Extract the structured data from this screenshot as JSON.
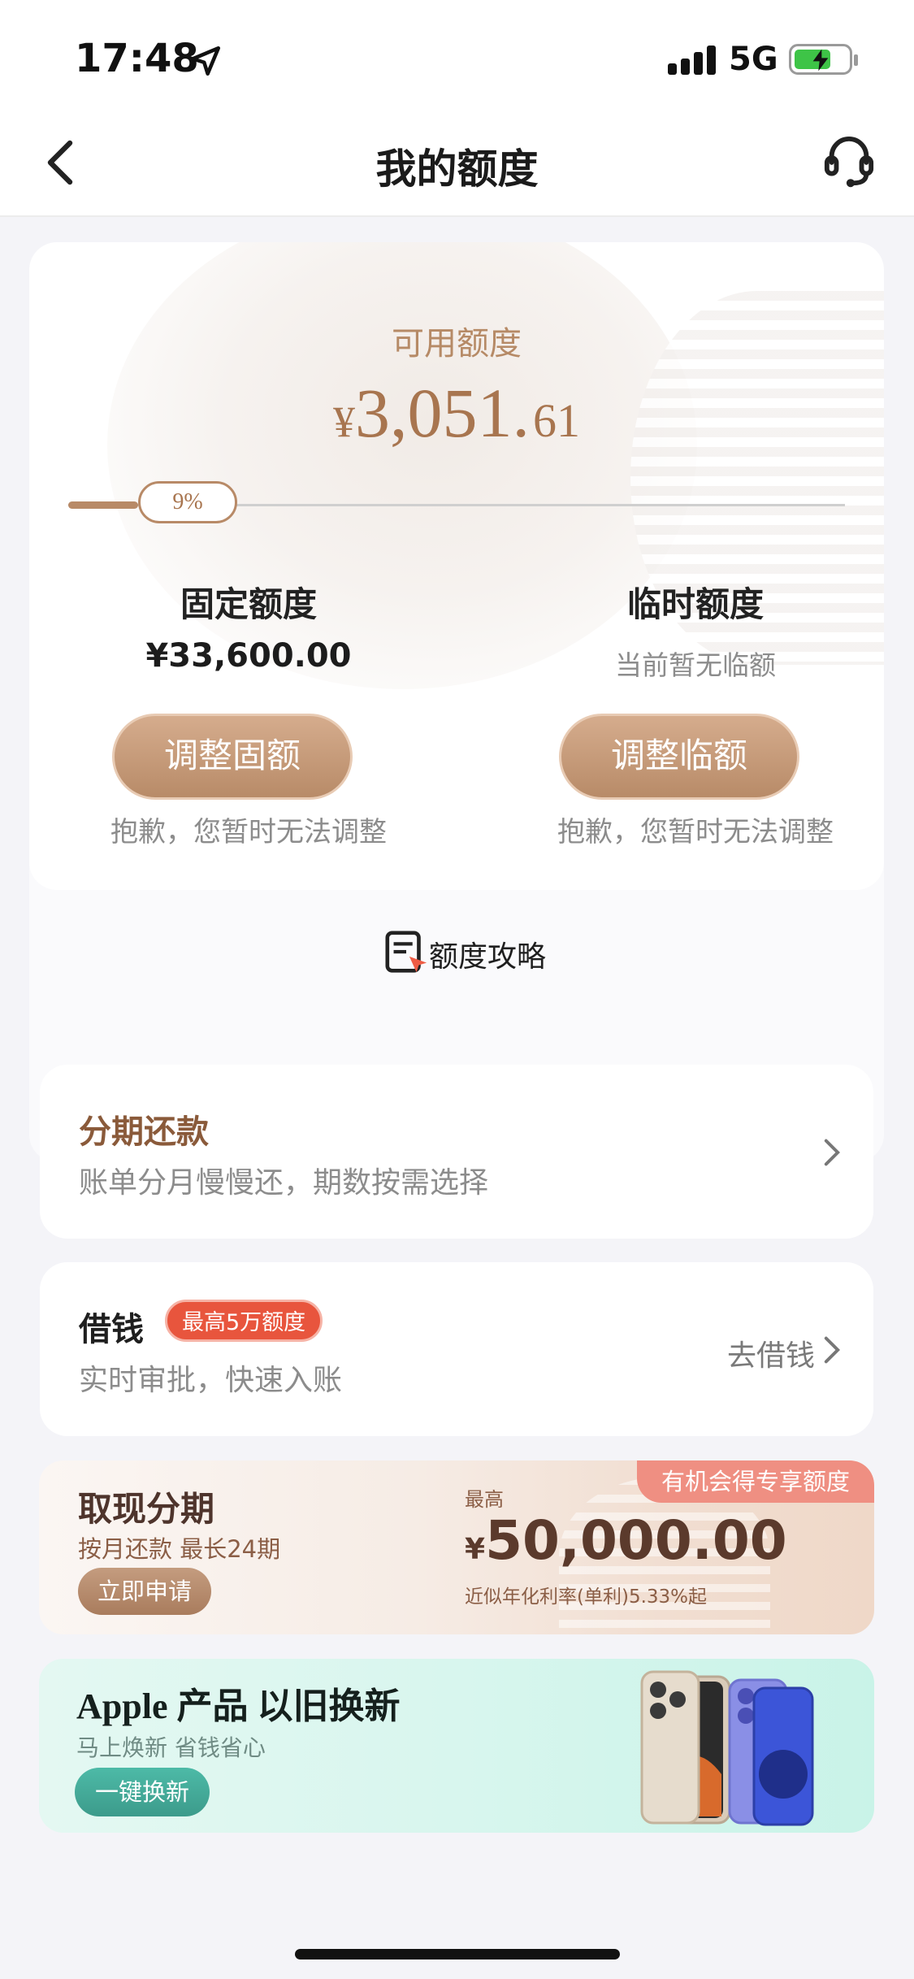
{
  "status_bar": {
    "time": "17:48",
    "network": "5G"
  },
  "nav": {
    "title": "我的额度"
  },
  "credit": {
    "available_label": "可用额度",
    "available_currency": "¥",
    "available_int": "3,051.",
    "available_dec": "61",
    "usage_percent_label": "9%",
    "usage_fraction": 0.09,
    "fixed": {
      "title": "固定额度",
      "value": "¥33,600.00",
      "button": "调整固额",
      "note": "抱歉，您暂时无法调整"
    },
    "temp": {
      "title": "临时额度",
      "value": "当前暂无临额",
      "button": "调整临额",
      "note": "抱歉，您暂时无法调整"
    },
    "strategy_label": "额度攻略"
  },
  "installment": {
    "title": "分期还款",
    "subtitle": "账单分月慢慢还，期数按需选择"
  },
  "borrow": {
    "title": "借钱",
    "badge": "最高5万额度",
    "subtitle": "实时审批，快速入账",
    "action": "去借钱"
  },
  "cash": {
    "title": "取现分期",
    "subtitle": "按月还款 最长24期",
    "button": "立即申请",
    "max_label": "最高",
    "currency": "¥",
    "amount": "50,000.00",
    "rate": "近似年化利率(单利)5.33%起",
    "ribbon": "有机会得专享额度"
  },
  "apple": {
    "title": "Apple 产品 以旧换新",
    "subtitle": "马上焕新 省钱省心",
    "button": "一键换新"
  },
  "colors": {
    "accent": "#b88a67",
    "badge_red": "#e8553d",
    "teal": "#4dbaa7"
  }
}
